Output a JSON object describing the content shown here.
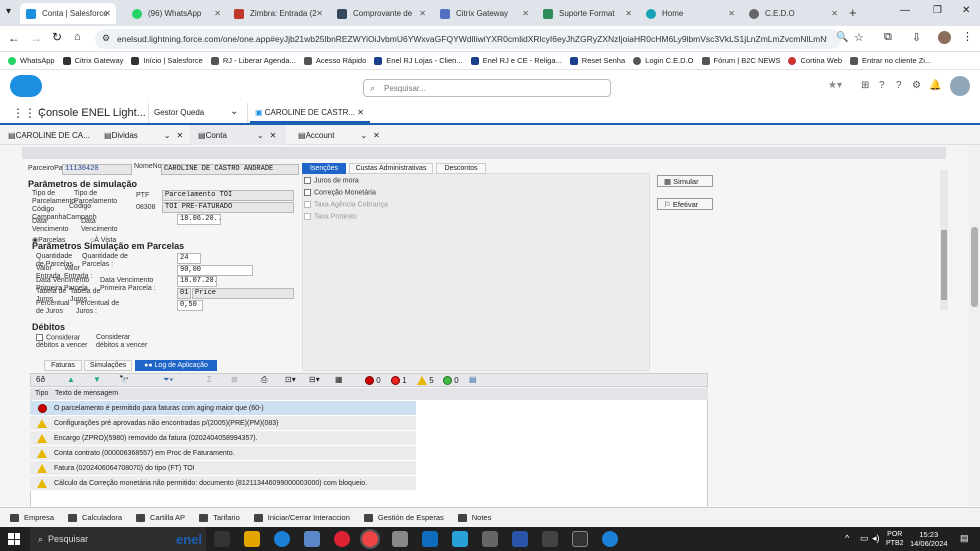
{
  "browser_tabs": [
    {
      "label": "Conta | Salesforce",
      "color": "#1b8fe0",
      "active": true
    },
    {
      "label": "(96) WhatsApp",
      "color": "#25d366"
    },
    {
      "label": "Zimbra: Entrada (2",
      "color": "#c0392b"
    },
    {
      "label": "Comprovante de ",
      "color": "#34495e"
    },
    {
      "label": "Citrix Gateway",
      "color": "#5271c2"
    },
    {
      "label": "Suporte Format",
      "color": "#2e8b57"
    },
    {
      "label": "Home",
      "color": "#17a2b8"
    },
    {
      "label": "C.E.D.O",
      "color": "#666666"
    }
  ],
  "url": "enelsud.lightning.force.com/one/one.app#eyJjb21wb25lbnREZWYiOiJvbmU6YWxvaGFQYWdlIiwiYXR0cmlidXRlcyI6eyJhZGRyZXNzIjoiaHR0cHM6Ly9lbmVsc3VkLS1jLnZmLmZvcmNlLmNvbS9...",
  "bookmarks": [
    "WhatsApp",
    "Citrix Gateway",
    "Início | Salesforce",
    "RJ - Liberar Agenda...",
    "Acesso Rápido",
    "Enel RJ Lojas - Clien...",
    "Enel RJ e CE - Religa...",
    "Reset Senha",
    "Login C.E.D.O",
    "Fórum | B2C NEWS",
    "Cortina Web",
    "Entrar no cliente Zi..."
  ],
  "search_placeholder": "Pesquisar...",
  "app_name": "Console ENEL Light...",
  "nav_item": "Gestor Queda",
  "record_tab": "CAROLINE DE CASTR...",
  "subtabs": [
    "CAROLINE DE CA...",
    "Dividas",
    "Conta",
    "Account"
  ],
  "form": {
    "parceiro_label": "ParceiroPar",
    "parceiro_value": "11130420",
    "nome_label": "NomeNo",
    "nome_value": "CAROLINE DE CASTRO ANDRADE",
    "params_title": "Parâmetros de simulação",
    "tipo_label1": "Tipo de Parcelamento",
    "tipo_label2": "Tipo de Parcelamento",
    "codigo_label": "Código CampanhaCampanh",
    "codigo_label2": "Código",
    "ptf": "PTF",
    "ptf_value": "Parcelamento TOI",
    "code": "08308",
    "code_value": "TOI PRÉ-FATURADO",
    "data_venc_label": "Data Vencimento",
    "data_venc_label2": "Data Vencimento",
    "data_venc_value": "18.06.20..",
    "parcelas_radio": "Parcelas",
    "avista_radio": "À Vista",
    "parcelas_title": "Parâmetros Simulação em Parcelas",
    "qtd_label": "Quantidade de Parcelas",
    "qtd_label2": "Quantidade de Parcelas :",
    "qtd_value": "24",
    "valor_label": "Valor Entrada",
    "valor_label2": "Valor Entrada :",
    "valor_value": "90,00",
    "dvp_label": "Data Vencimento Primeira Parcela",
    "dvp_label2": "Data Vencimento Primeira Parcela :",
    "dvp_value": "18.07.20..",
    "tab_label": "Tabela de Juros",
    "tab_label2": "Tabela de Juros :",
    "tab_code": "01",
    "tab_value": "Price",
    "perc_label": "Percentual de Juros",
    "perc_label2": "Percentual de Juros :",
    "perc_value": "0,50",
    "debitos_title": "Débitos",
    "considerar1": "Considerar débitos a vencer",
    "considerar2": "Considerar débitos a vencer"
  },
  "tabs_right": [
    "Isenções",
    "Custas Administrativas",
    "Descontos"
  ],
  "isencoes": [
    "Juros de mora",
    "Correção Monetária",
    "Taxa Agência Cobrança",
    "Taxa Protesto"
  ],
  "buttons": {
    "simular": "Simular",
    "efetivar": "Efetivar"
  },
  "bottom_tabs": [
    "Faturas",
    "Simulações",
    "Log de Aplicação"
  ],
  "counters": {
    "red": "0",
    "red2": "1",
    "yellow": "5",
    "green": "0"
  },
  "log_headers": {
    "tipo": "Tipo",
    "texto": "Texto de mensagem"
  },
  "log_rows": [
    {
      "type": "error",
      "text": "O parcelamento é permitido para faturas com aging maior que (60-)"
    },
    {
      "type": "warning",
      "text": "Configurações pré aprovadas não encontradas p/(2005)(PRE)(PM)(083)"
    },
    {
      "type": "warning",
      "text": "Encargo (ZPRO)(5980) removido da fatura (0202404058994357)."
    },
    {
      "type": "warning",
      "text": "Conta contrato (000006368557) em Proc de Faturamento."
    },
    {
      "type": "warning",
      "text": "Fatura (0202406064708070) do tipo (FT) TOI"
    },
    {
      "type": "warning",
      "text": "Cálculo da Correção monetária não permitido: documento (812113446099000003000) com bloqueio."
    }
  ],
  "footer_items": [
    "Empresa",
    "Calculadora",
    "Cartilla AP",
    "Tarifario",
    "Iniciar/Cerrar Interaccion",
    "Gestión de Esperas",
    "Notes"
  ],
  "taskbar": {
    "search": "Pesquisar",
    "lang1": "POR",
    "lang2": "PTB2",
    "time": "15:23",
    "date": "14/06/2024"
  }
}
